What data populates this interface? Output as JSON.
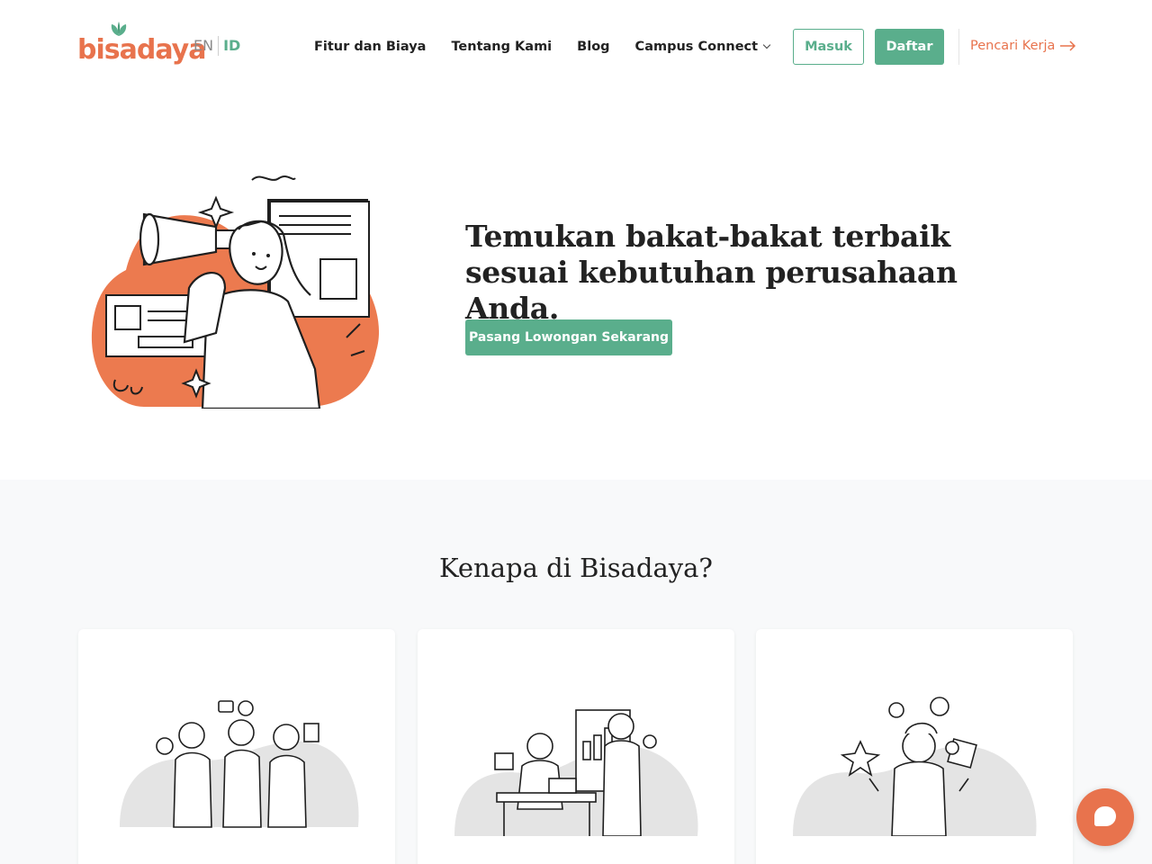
{
  "header": {
    "logo_text": "bisadaya",
    "lang": {
      "en": "EN",
      "id": "ID",
      "active": "ID"
    },
    "nav": [
      {
        "label": "Fitur dan Biaya"
      },
      {
        "label": "Tentang Kami"
      },
      {
        "label": "Blog"
      },
      {
        "label": "Campus Connect",
        "has_dropdown": true
      }
    ],
    "masuk_label": "Masuk",
    "daftar_label": "Daftar",
    "pencari_label": "Pencari Kerja"
  },
  "hero": {
    "title": "Temukan bakat-bakat terbaik sesuai kebutuhan perusahaan Anda.",
    "cta_label": "Pasang Lowongan Sekarang"
  },
  "why": {
    "title": "Kenapa di Bisadaya?",
    "cards": [
      {
        "illustration": "team-collaboration-illustration"
      },
      {
        "illustration": "data-analysis-illustration"
      },
      {
        "illustration": "ai-matching-illustration"
      }
    ]
  },
  "chat": {
    "icon": "chat-bubble-icon"
  },
  "colors": {
    "brand_orange": "#e8734d",
    "brand_green": "#5aae8c",
    "section_bg": "#f8f9fa",
    "text_dark": "#222222"
  }
}
